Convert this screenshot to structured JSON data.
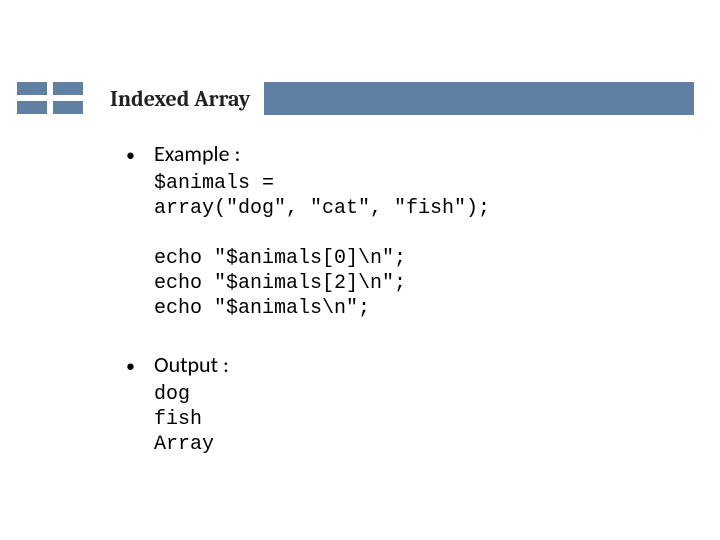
{
  "title": "Indexed Array",
  "sections": [
    {
      "label": "Example :",
      "code_lines": [
        "$animals =",
        "array(\"dog\", \"cat\", \"fish\");",
        "",
        "echo \"$animals[0]\\n\";",
        "echo \"$animals[2]\\n\";",
        "echo \"$animals\\n\";"
      ]
    },
    {
      "label": "Output :",
      "code_lines": [
        "dog",
        "fish",
        "Array"
      ]
    }
  ],
  "bullet_glyph": "•"
}
